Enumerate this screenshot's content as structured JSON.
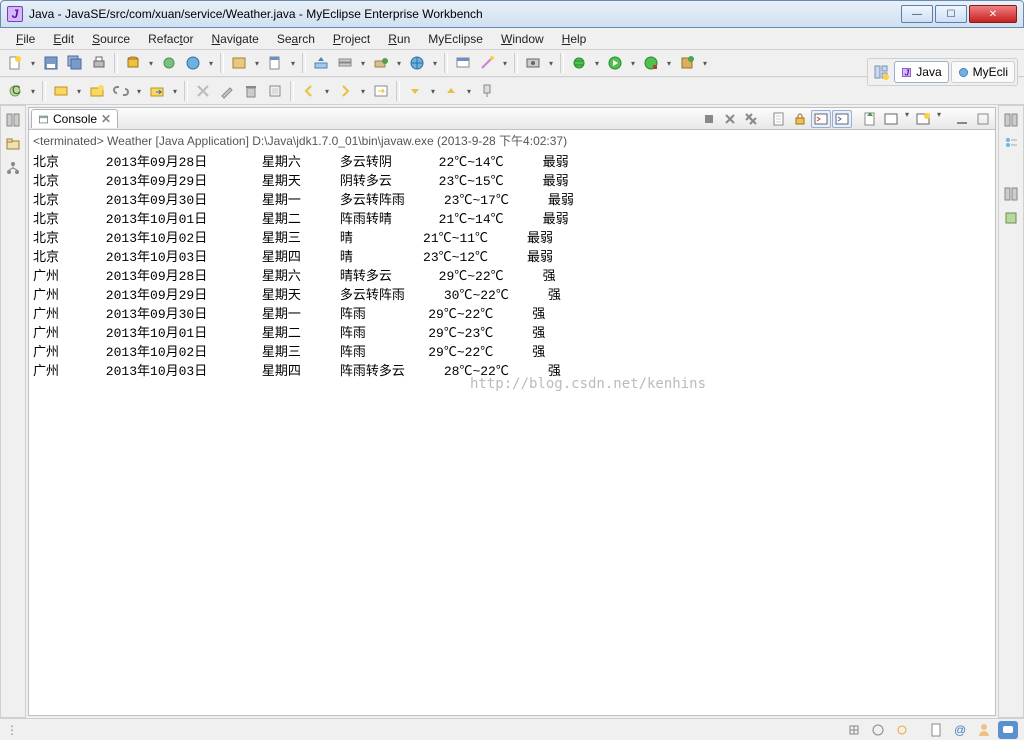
{
  "titlebar": {
    "text": "Java - JavaSE/src/com/xuan/service/Weather.java - MyEclipse Enterprise Workbench"
  },
  "menus": [
    "File",
    "Edit",
    "Source",
    "Refactor",
    "Navigate",
    "Search",
    "Project",
    "Run",
    "MyEclipse",
    "Window",
    "Help"
  ],
  "perspective": {
    "java": "Java",
    "myecli": "MyEcli"
  },
  "console": {
    "label": "Console",
    "header": "<terminated> Weather [Java Application] D:\\Java\\jdk1.7.0_01\\bin\\javaw.exe (2013-9-28 下午4:02:37)",
    "rows": [
      {
        "city": "北京",
        "date": "2013年09月28日",
        "dow": "星期六",
        "cond": "多云转阴",
        "temp": "22℃~14℃",
        "wind": "最弱"
      },
      {
        "city": "北京",
        "date": "2013年09月29日",
        "dow": "星期天",
        "cond": "阴转多云",
        "temp": "23℃~15℃",
        "wind": "最弱"
      },
      {
        "city": "北京",
        "date": "2013年09月30日",
        "dow": "星期一",
        "cond": "多云转阵雨",
        "temp": "23℃~17℃",
        "wind": "最弱"
      },
      {
        "city": "北京",
        "date": "2013年10月01日",
        "dow": "星期二",
        "cond": "阵雨转晴",
        "temp": "21℃~14℃",
        "wind": "最弱"
      },
      {
        "city": "北京",
        "date": "2013年10月02日",
        "dow": "星期三",
        "cond": "晴",
        "temp": "21℃~11℃",
        "wind": "最弱"
      },
      {
        "city": "北京",
        "date": "2013年10月03日",
        "dow": "星期四",
        "cond": "晴",
        "temp": "23℃~12℃",
        "wind": "最弱"
      },
      {
        "city": "广州",
        "date": "2013年09月28日",
        "dow": "星期六",
        "cond": "晴转多云",
        "temp": "29℃~22℃",
        "wind": "强"
      },
      {
        "city": "广州",
        "date": "2013年09月29日",
        "dow": "星期天",
        "cond": "多云转阵雨",
        "temp": "30℃~22℃",
        "wind": "强"
      },
      {
        "city": "广州",
        "date": "2013年09月30日",
        "dow": "星期一",
        "cond": "阵雨",
        "temp": "29℃~22℃",
        "wind": "强"
      },
      {
        "city": "广州",
        "date": "2013年10月01日",
        "dow": "星期二",
        "cond": "阵雨",
        "temp": "29℃~23℃",
        "wind": "强"
      },
      {
        "city": "广州",
        "date": "2013年10月02日",
        "dow": "星期三",
        "cond": "阵雨",
        "temp": "29℃~22℃",
        "wind": "强"
      },
      {
        "city": "广州",
        "date": "2013年10月03日",
        "dow": "星期四",
        "cond": "阵雨转多云",
        "temp": "28℃~22℃",
        "wind": "强"
      }
    ]
  },
  "watermark": "http://blog.csdn.net/kenhins",
  "status": {
    "hint": "⋮"
  }
}
